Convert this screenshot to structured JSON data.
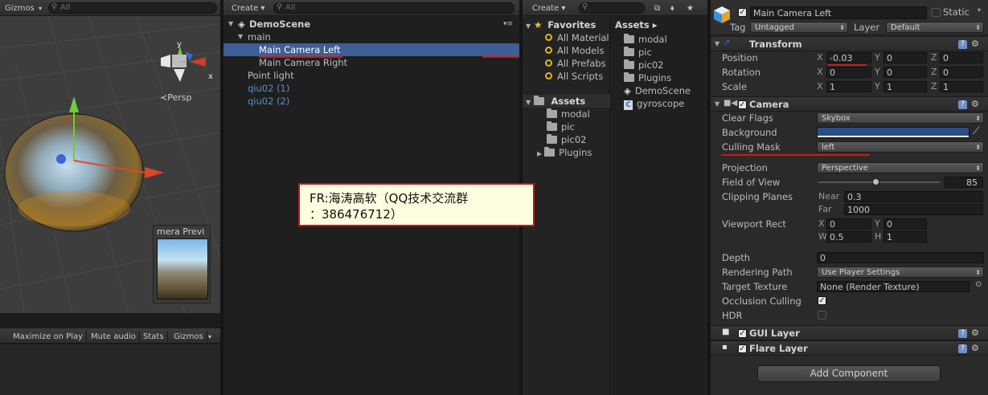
{
  "scene": {
    "gizmos": "Gizmos",
    "search_placeholder": "All",
    "persp": "Persp",
    "axis_x": "x",
    "axis_y": "y",
    "camera_preview_title": "mera Previ"
  },
  "game_bar": {
    "maximize_on_play": "Maximize on Play",
    "mute_audio": "Mute audio",
    "stats": "Stats",
    "gizmos": "Gizmos"
  },
  "hierarchy": {
    "create": "Create",
    "search_placeholder": "All",
    "scene_name": "DemoScene",
    "items": [
      {
        "label": "main"
      },
      {
        "label": "Main Camera Left"
      },
      {
        "label": "Main Camera Right"
      },
      {
        "label": "Point light"
      },
      {
        "label": "qiu02 (1)"
      },
      {
        "label": "qiu02 (2)"
      }
    ]
  },
  "project": {
    "create": "Create",
    "favorites": "Favorites",
    "favorite_items": [
      "All Material",
      "All Models",
      "All Prefabs",
      "All Scripts"
    ],
    "assets": "Assets",
    "asset_tree": [
      "modal",
      "pic",
      "pic02",
      "Plugins"
    ],
    "breadcrumb": "Assets ▸",
    "contents": [
      "modal",
      "pic",
      "pic02",
      "Plugins",
      "DemoScene",
      "gyroscope"
    ]
  },
  "inspector": {
    "object_name": "Main Camera Left",
    "static_label": "Static",
    "tag_label": "Tag",
    "tag_value": "Untagged",
    "layer_label": "Layer",
    "layer_value": "Default",
    "transform": {
      "title": "Transform",
      "position_label": "Position",
      "rotation_label": "Rotation",
      "scale_label": "Scale",
      "position": {
        "x": "-0.03",
        "y": "0",
        "z": "0"
      },
      "rotation": {
        "x": "0",
        "y": "0",
        "z": "0"
      },
      "scale": {
        "x": "1",
        "y": "1",
        "z": "1"
      },
      "x": "X",
      "y": "Y",
      "z": "Z"
    },
    "camera": {
      "title": "Camera",
      "clear_flags_label": "Clear Flags",
      "clear_flags": "Skybox",
      "background_label": "Background",
      "background_color": "#2a4e86",
      "culling_mask_label": "Culling Mask",
      "culling_mask": "left",
      "projection_label": "Projection",
      "projection": "Perspective",
      "fov_label": "Field of View",
      "fov": "85",
      "fov_fraction": 0.47,
      "clipping_label": "Clipping Planes",
      "near_label": "Near",
      "near": "0.3",
      "far_label": "Far",
      "far": "1000",
      "viewport_label": "Viewport Rect",
      "vp": {
        "x": "0",
        "y": "0",
        "w": "0.5",
        "h": "1"
      },
      "vp_labels": {
        "x": "X",
        "y": "Y",
        "w": "W",
        "h": "H"
      },
      "depth_label": "Depth",
      "depth": "0",
      "rendering_path_label": "Rendering Path",
      "rendering_path": "Use Player Settings",
      "target_texture_label": "Target Texture",
      "target_texture": "None (Render Texture)",
      "occlusion_label": "Occlusion Culling",
      "hdr_label": "HDR"
    },
    "gui_layer": "GUI Layer",
    "flare_layer": "Flare Layer",
    "add_component": "Add Component"
  },
  "watermark": {
    "line1": "FR:海涛高软（QQ技术交流群",
    "line2": "：386476712）"
  }
}
